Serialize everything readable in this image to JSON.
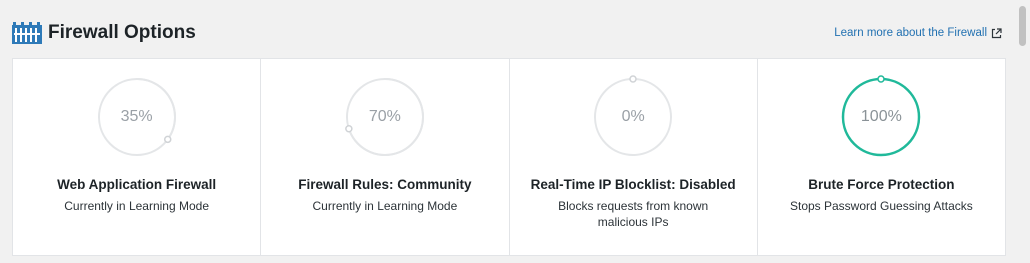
{
  "header": {
    "title": "Firewall Options",
    "learn_more": "Learn more about the Firewall",
    "icon": "firewall-icon"
  },
  "colors": {
    "accent": "#20b99a",
    "track": "#e4e6e8",
    "link": "#2271b1"
  },
  "cards": [
    {
      "percent_text": "35%",
      "percent": 0.35,
      "title": "Web Application Firewall",
      "subtitle": "Currently in Learning Mode"
    },
    {
      "percent_text": "70%",
      "percent": 0.7,
      "title": "Firewall Rules: Community",
      "subtitle": "Currently in Learning Mode"
    },
    {
      "percent_text": "0%",
      "percent": 0.0,
      "title": "Real-Time IP Blocklist: Disabled",
      "subtitle": "Blocks requests from known malicious IPs"
    },
    {
      "percent_text": "100%",
      "percent": 1.0,
      "title": "Brute Force Protection",
      "subtitle": "Stops Password Guessing Attacks"
    }
  ]
}
